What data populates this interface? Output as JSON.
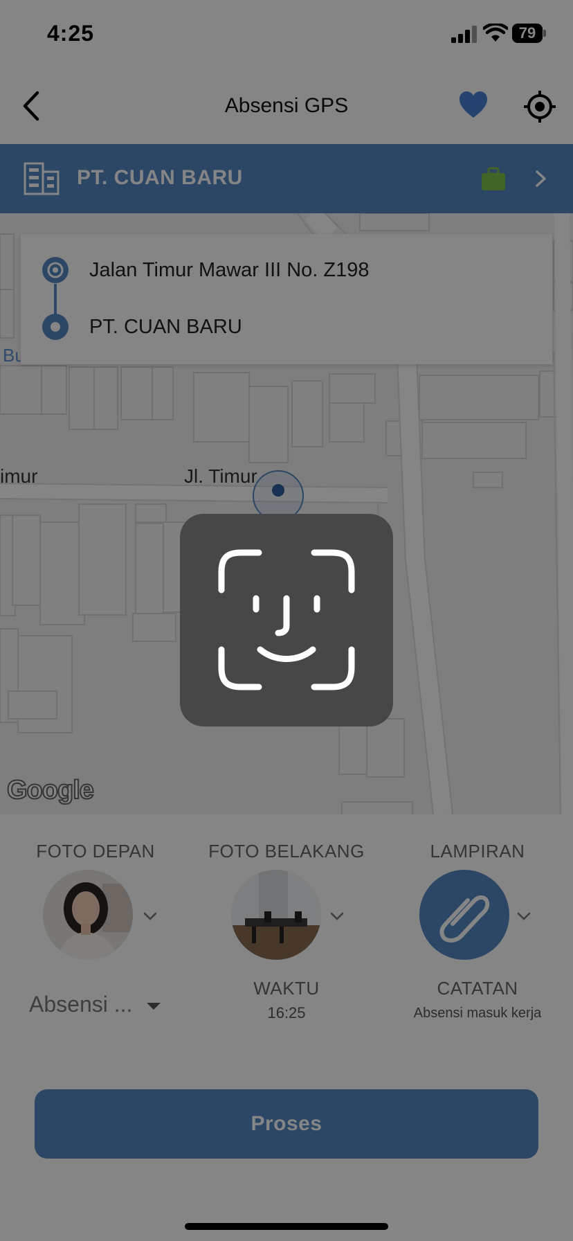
{
  "status_bar": {
    "time": "4:25",
    "battery": "79"
  },
  "nav": {
    "title": "Absensi GPS",
    "icons": [
      "back-chevron-icon",
      "heart-icon",
      "crosshair-locate-icon"
    ]
  },
  "company": {
    "name": "PT. CUAN BARU",
    "icons": [
      "building-icon",
      "briefcase-icon",
      "chevron-right-icon"
    ]
  },
  "route": {
    "origin": "Jalan Timur Mawar III No. Z198",
    "destination": "PT. CUAN BARU"
  },
  "map": {
    "labels": {
      "street_left": "imur",
      "street_center": "Jl. Timur",
      "place_left": "Bu",
      "attribution": "Google"
    }
  },
  "attachments": {
    "front_photo_label": "FOTO DEPAN",
    "back_photo_label": "FOTO BELAKANG",
    "attachment_label": "LAMPIRAN"
  },
  "form": {
    "type_value": "Absensi ...",
    "time_label": "WAKTU",
    "time_value": "16:25",
    "note_label": "CATATAN",
    "note_value": "Absensi masuk kerja"
  },
  "actions": {
    "submit_label": "Proses"
  },
  "colors": {
    "primary": "#5588c4",
    "briefcase": "#7cc24a",
    "overlay": "rgba(0,0,0,0.48)",
    "faceid_bg": "#474747"
  }
}
